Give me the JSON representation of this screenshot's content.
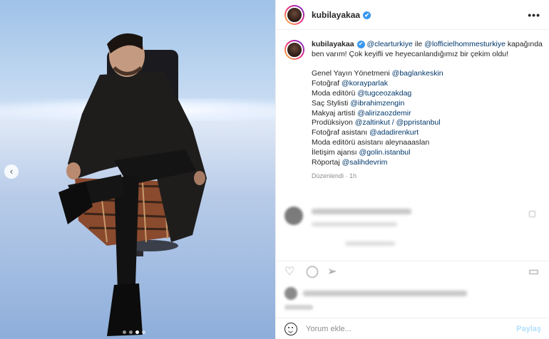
{
  "post": {
    "username": "kubilayakaa",
    "verified_glyph": "✔",
    "more_label": "•••",
    "caption": {
      "line1_pre": "",
      "mention1": "@clearturkiye",
      "conj": " ile ",
      "mention2": "@lofficielhommesturkiye",
      "line2": " kapağında ben varım! Çok keyifli ve heyecanlandığımız bir çekim oldu!",
      "credits": [
        {
          "label": "Genel Yayın Yönetmeni ",
          "mention": "@baglankeskin"
        },
        {
          "label": "Fotoğraf ",
          "mention": "@korayparlak"
        },
        {
          "label": "Moda editörü ",
          "mention": "@tugceozakdag"
        },
        {
          "label": "Saç Stylisti ",
          "mention": "@ibrahimzengin"
        },
        {
          "label": "Makyaj artisti ",
          "mention": "@alirizaozdemir"
        },
        {
          "label": "Prodüksiyon ",
          "mention": "@zaltinkut / @ppristanbul"
        },
        {
          "label": "Fotoğraf asistanı ",
          "mention": "@adadirenkurt"
        },
        {
          "label": "Moda editörü asistanı aleynaaaslan",
          "mention": ""
        },
        {
          "label": "İletişim ajansı ",
          "mention": "@golin.istanbul"
        },
        {
          "label": "Röportaj ",
          "mention": "@salihdevrim"
        }
      ],
      "timestamp": "Düzenlendi · 1h"
    },
    "comment": {
      "reply_label": ""
    },
    "comment_box": {
      "placeholder": "Yorum ekle...",
      "post_label": "Paylaş"
    },
    "carousel": {
      "slides": 4,
      "active": 3,
      "prev_glyph": "‹"
    }
  },
  "icons": {
    "heart": "heart-icon",
    "comment": "comment-icon",
    "share": "share-icon",
    "save": "bookmark-icon",
    "emoji": "emoji-icon",
    "more": "more-icon"
  },
  "colors": {
    "mention": "#00376b",
    "verified": "#3897f0",
    "post_button": "#b2dffc"
  }
}
